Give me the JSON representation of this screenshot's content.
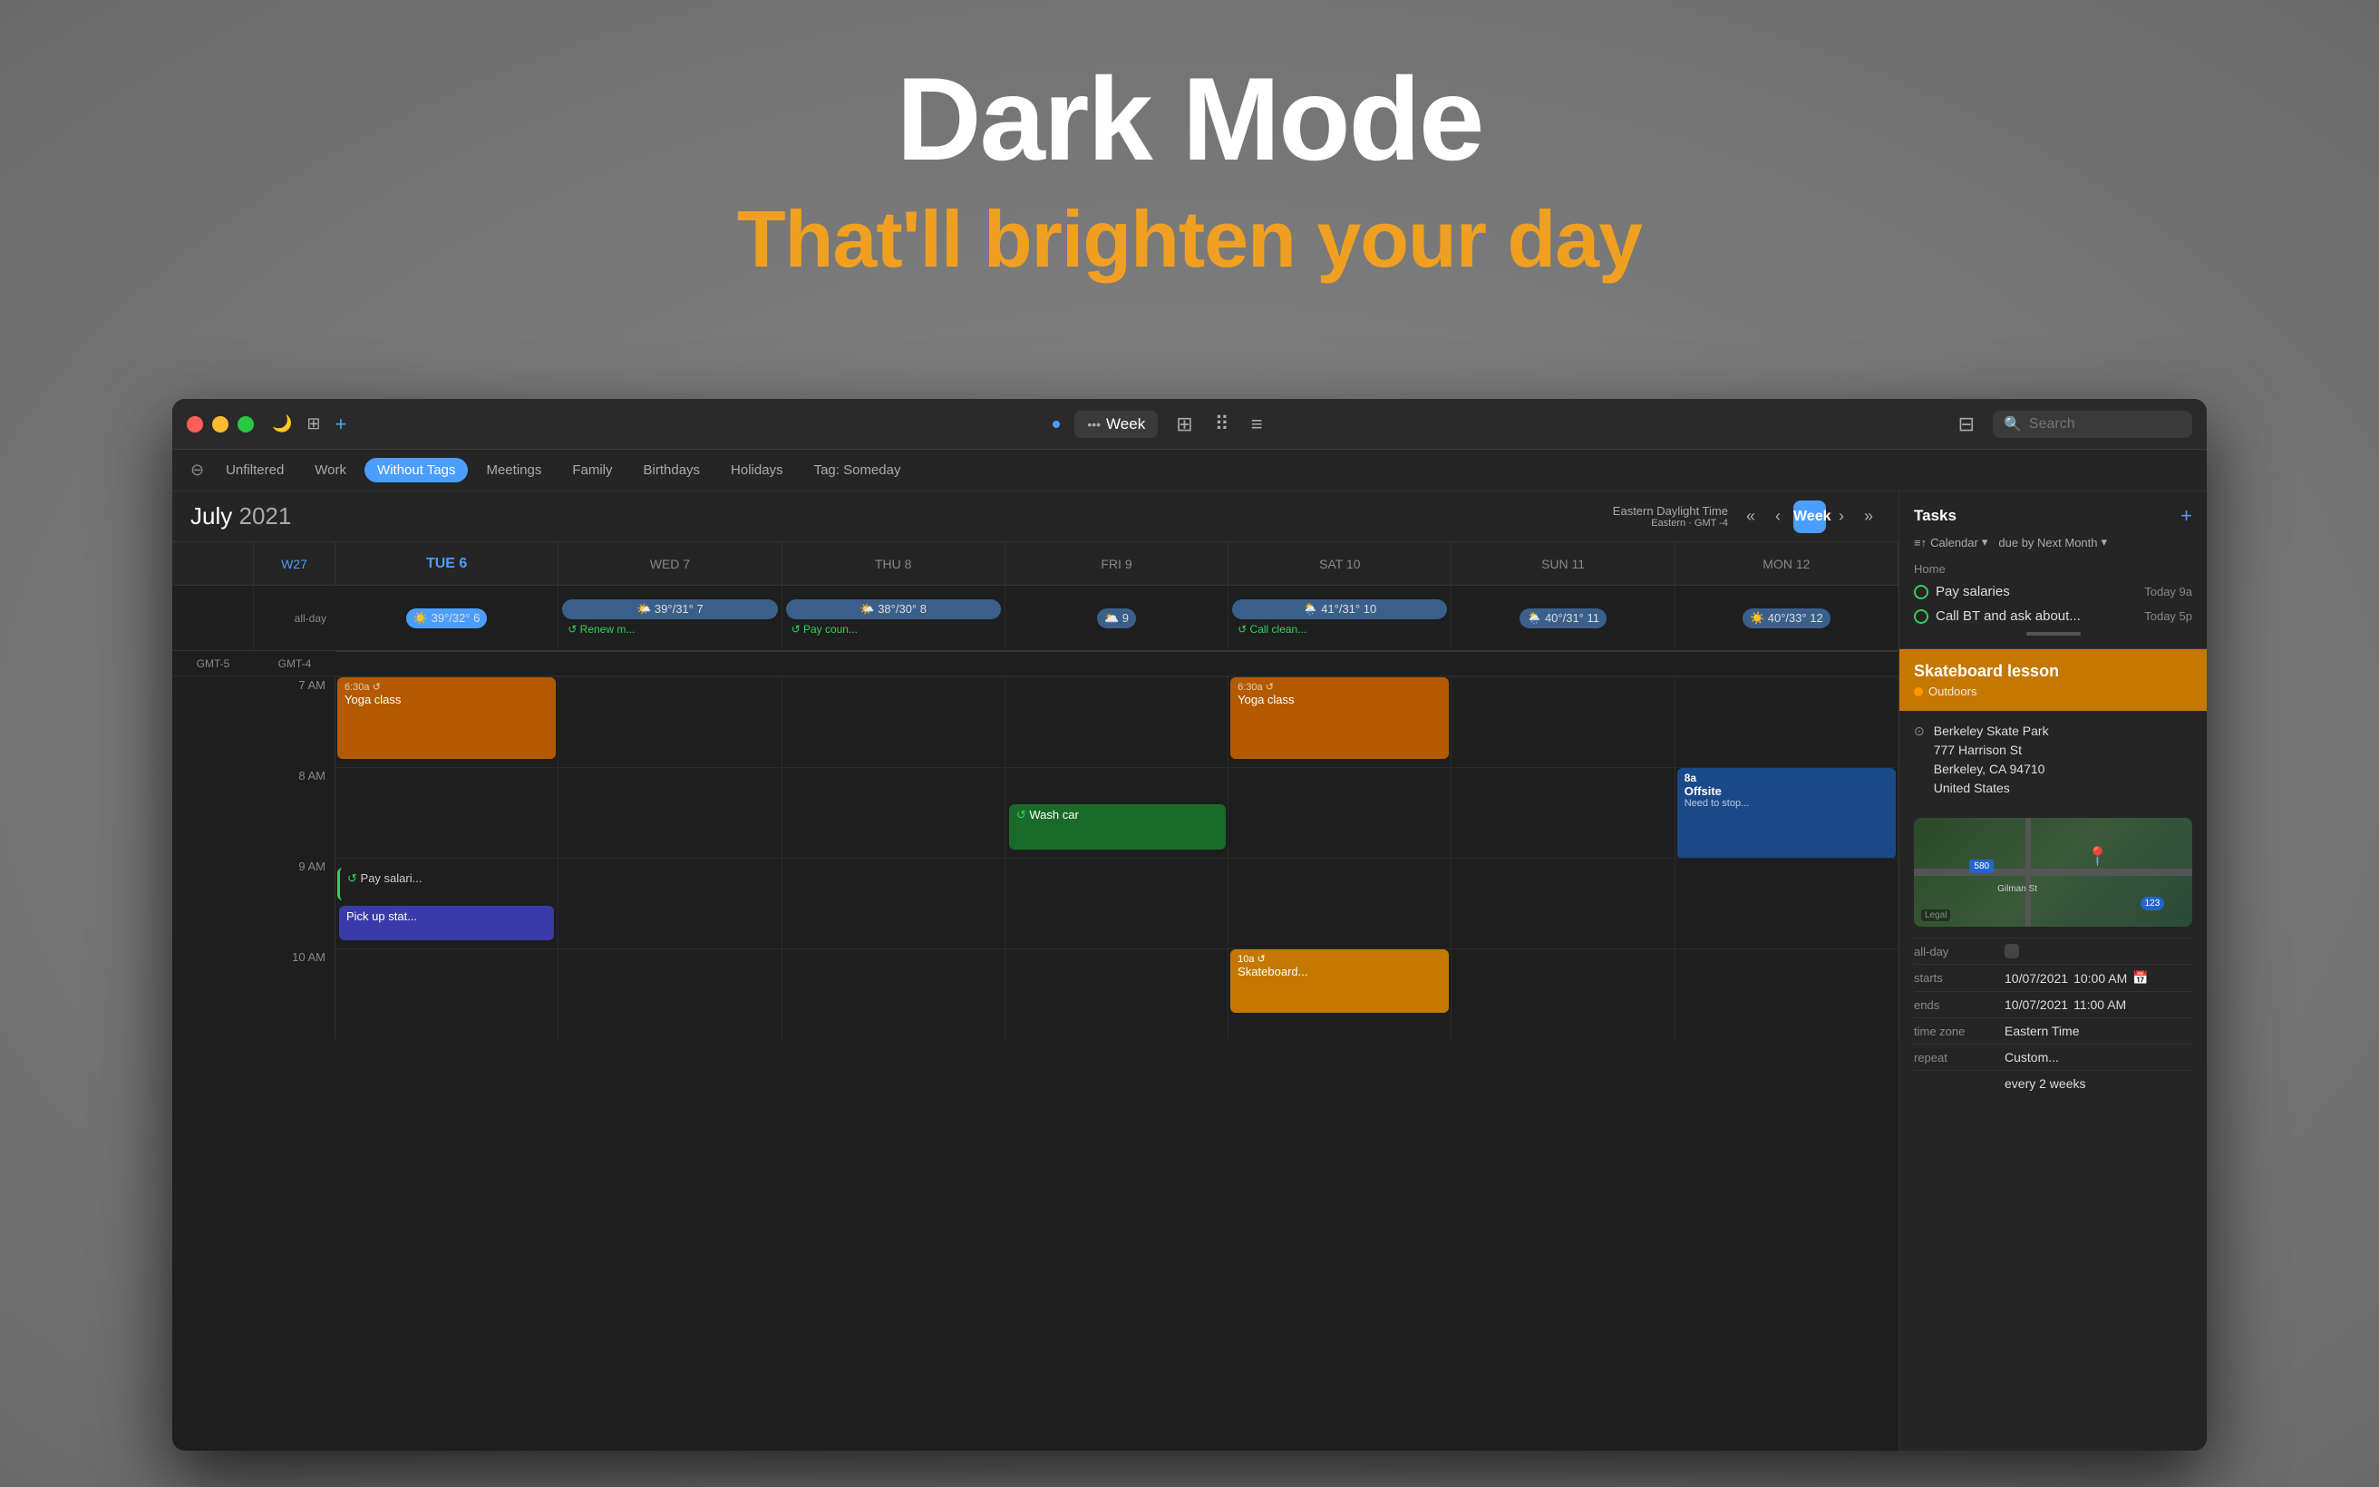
{
  "hero": {
    "title": "Dark Mode",
    "subtitle": "That'll brighten your day"
  },
  "window": {
    "titlebar": {
      "traffic_lights": [
        "red",
        "yellow",
        "green"
      ],
      "icons": [
        "moon",
        "layout"
      ],
      "add_icon": "+",
      "dot_label": "•••",
      "week_label": "Week",
      "grid_icon": "⊞",
      "apps_icon": "⠿",
      "list_icon": "≡",
      "panel_icon": "⊟",
      "search_placeholder": "Search"
    },
    "filterbar": {
      "minus_icon": "⊖",
      "filters": [
        {
          "label": "Unfiltered",
          "active": false
        },
        {
          "label": "Work",
          "active": false
        },
        {
          "label": "Without Tags",
          "active": true
        },
        {
          "label": "Meetings",
          "active": false
        },
        {
          "label": "Family",
          "active": false
        },
        {
          "label": "Birthdays",
          "active": false
        },
        {
          "label": "Holidays",
          "active": false
        },
        {
          "label": "Tag: Someday",
          "active": false
        }
      ]
    },
    "calendar": {
      "month_year": "July 2021",
      "month_color": "white",
      "year_color": "#aaa",
      "timezone": "Eastern Daylight Time",
      "timezone_sub": "Eastern · GMT -4",
      "nav_buttons": [
        "«",
        "‹",
        "›",
        "»"
      ],
      "today_number": "6",
      "days": [
        {
          "label": "W27",
          "is_week": true
        },
        {
          "label": "TUE",
          "day": "6",
          "current": true
        },
        {
          "label": "WED",
          "day": "7"
        },
        {
          "label": "THU",
          "day": "8"
        },
        {
          "label": "FRI",
          "day": "9"
        },
        {
          "label": "SAT",
          "day": "10"
        },
        {
          "label": "SUN",
          "day": "11"
        },
        {
          "label": "MON",
          "day": "12"
        }
      ],
      "weather": [
        {
          "day": "TUE",
          "icon": "☀️",
          "hi": "39°",
          "lo": "32°",
          "today": true
        },
        {
          "day": "WED",
          "icon": "🌤️",
          "hi": "39°",
          "lo": "31°"
        },
        {
          "day": "THU",
          "icon": "🌤️",
          "hi": "38°",
          "lo": "30°"
        },
        {
          "day": "FRI",
          "icon": "🌥️",
          "lo": ""
        },
        {
          "day": "SAT",
          "icon": "🌦️",
          "hi": "41°",
          "lo": "31°"
        },
        {
          "day": "SUN",
          "icon": "🌦️",
          "hi": "40°",
          "lo": "31°"
        },
        {
          "day": "MON",
          "icon": "☀️",
          "hi": "40°",
          "lo": "33°"
        }
      ],
      "allday_events": [
        {
          "day": "WED",
          "text": "↺ Renew m...",
          "color": "green"
        },
        {
          "day": "THU",
          "text": "↺ Pay coun...",
          "color": "green"
        },
        {
          "day": "SAT",
          "text": "↺ Call clean...",
          "color": "green"
        }
      ],
      "gmt_labels": [
        "GMT-5",
        "GMT-4"
      ],
      "time_slots": [
        {
          "gmt": "",
          "local": "7 AM"
        },
        {
          "gmt": "",
          "local": "8 AM"
        },
        {
          "gmt": "",
          "local": "9 AM"
        },
        {
          "gmt": "",
          "local": "10 AM"
        }
      ],
      "events": [
        {
          "title": "6:30a Yoga class",
          "day": "TUE",
          "time_row": 0,
          "color": "yoga",
          "icon": "↺"
        },
        {
          "title": "6:30a Yoga class",
          "day": "SAT",
          "time_row": 0,
          "color": "yoga",
          "icon": "↺"
        },
        {
          "title": "↺ Wash car",
          "day": "FRI",
          "time_row": 1,
          "color": "wash"
        },
        {
          "title": "↺ Pay salari...",
          "day": "TUE",
          "time_row": 2,
          "color": "pay"
        },
        {
          "title": "Pick up stat...",
          "day": "TUE",
          "time_row": 2,
          "color": "pickup"
        },
        {
          "title": "8a Offsite\nNeed to stop...",
          "day": "MON",
          "time_row": 1,
          "color": "offsite"
        },
        {
          "title": "10a Skateboard...",
          "day": "SAT",
          "time_row": 3,
          "color": "skateboard"
        }
      ]
    },
    "tasks": {
      "title": "Tasks",
      "add_icon": "+",
      "calendar_label": "Calendar",
      "due_label": "due by Next Month",
      "section": "Home",
      "items": [
        {
          "text": "Pay salaries",
          "time": "Today 9a"
        },
        {
          "text": "Call BT and ask about...",
          "time": "Today 5p"
        }
      ]
    },
    "event_detail": {
      "title": "Skateboard lesson",
      "calendar": "Outdoors",
      "location_name": "Berkeley Skate Park",
      "location_address": "777 Harrison St\nBerkeley, CA  94710\nUnited States",
      "allday_label": "all-day",
      "starts_label": "starts",
      "starts_date": "10/07/2021",
      "starts_time": "10:00 AM",
      "ends_label": "ends",
      "ends_date": "10/07/2021",
      "ends_time": "11:00 AM",
      "timezone_label": "time zone",
      "timezone_val": "Eastern Time",
      "repeat_label": "repeat",
      "repeat_val": "Custom...",
      "repeat_freq": "every 2 weeks",
      "map_580": "580",
      "map_123": "123",
      "map_street": "Gilman St",
      "map_legal": "Legal"
    }
  }
}
